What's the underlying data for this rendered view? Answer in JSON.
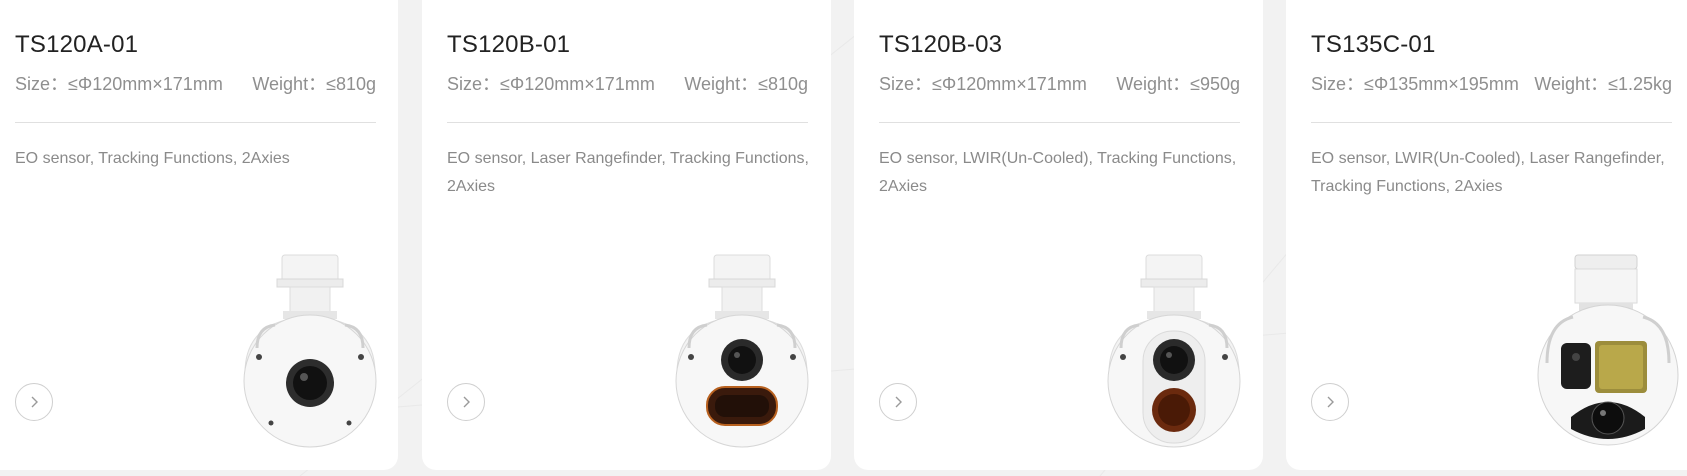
{
  "products": [
    {
      "name": "TS120A-01",
      "size": "Size：≤Φ120mm×171mm",
      "weight": "Weight：≤810g",
      "description": "EO sensor, Tracking Functions, 2Axies",
      "image_icon": "gimbal-eo-icon"
    },
    {
      "name": "TS120B-01",
      "size": "Size：≤Φ120mm×171mm",
      "weight": "Weight：≤810g",
      "description": "EO sensor, Laser Rangefinder, Tracking Functions, 2Axies",
      "image_icon": "gimbal-eo-laser-icon"
    },
    {
      "name": "TS120B-03",
      "size": "Size：≤Φ120mm×171mm",
      "weight": "Weight：≤950g",
      "description": "EO sensor, LWIR(Un-Cooled), Tracking Functions, 2Axies",
      "image_icon": "gimbal-eo-ir-icon"
    },
    {
      "name": "TS135C-01",
      "size": "Size：≤Φ135mm×195mm",
      "weight": "Weight：≤1.25kg",
      "description": "EO sensor, LWIR(Un-Cooled), Laser Rangefinder, Tracking Functions, 2Axies",
      "image_icon": "gimbal-tri-sensor-icon"
    }
  ],
  "colors": {
    "page_bg": "#f2f2f2",
    "card_bg": "#ffffff",
    "title": "#222222",
    "muted_text": "#8f8f8f",
    "divider": "#e0e0e0",
    "ir_window": "#6b2a0e",
    "laser_window": "#b9a84a"
  }
}
